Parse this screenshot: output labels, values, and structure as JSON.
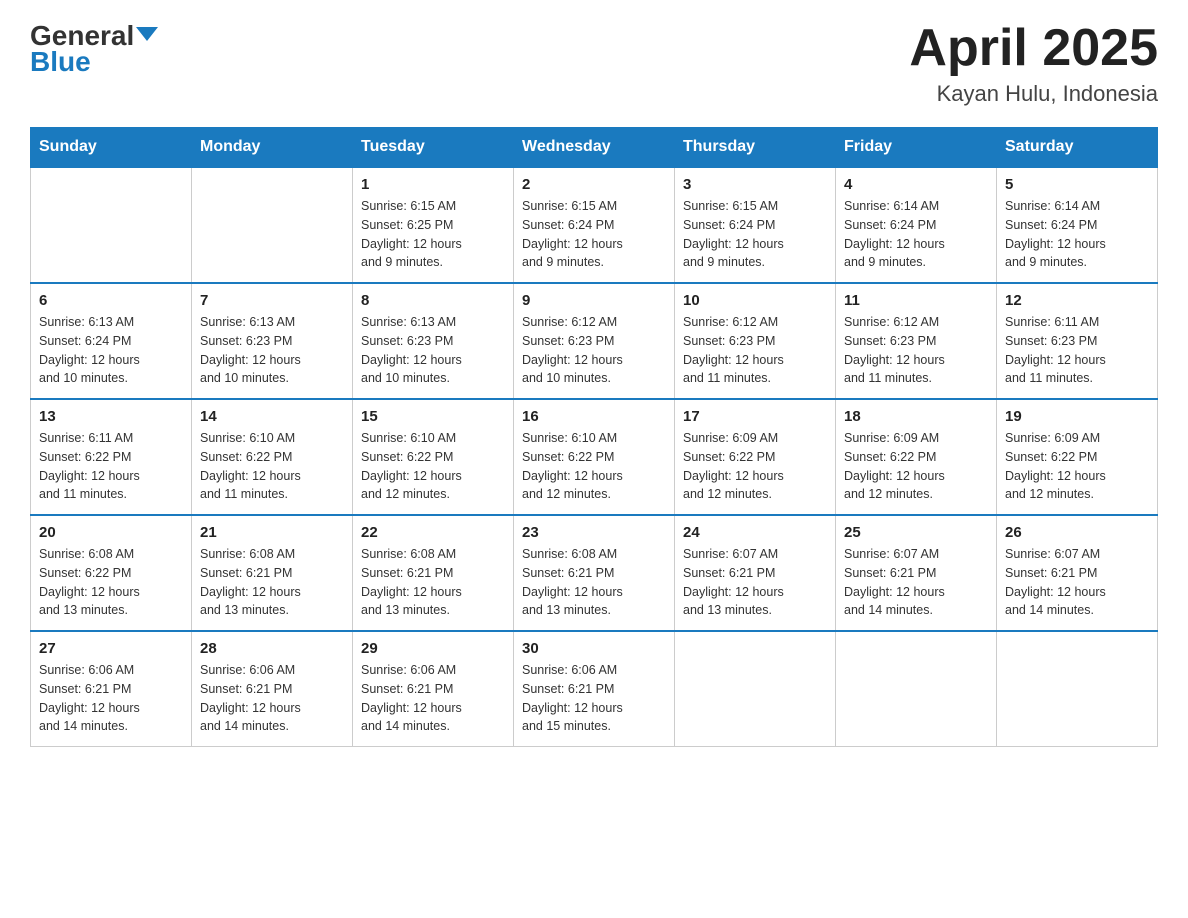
{
  "header": {
    "logo_general": "General",
    "logo_blue": "Blue",
    "title": "April 2025",
    "subtitle": "Kayan Hulu, Indonesia"
  },
  "days_of_week": [
    "Sunday",
    "Monday",
    "Tuesday",
    "Wednesday",
    "Thursday",
    "Friday",
    "Saturday"
  ],
  "weeks": [
    [
      {
        "day": "",
        "info": ""
      },
      {
        "day": "",
        "info": ""
      },
      {
        "day": "1",
        "info": "Sunrise: 6:15 AM\nSunset: 6:25 PM\nDaylight: 12 hours\nand 9 minutes."
      },
      {
        "day": "2",
        "info": "Sunrise: 6:15 AM\nSunset: 6:24 PM\nDaylight: 12 hours\nand 9 minutes."
      },
      {
        "day": "3",
        "info": "Sunrise: 6:15 AM\nSunset: 6:24 PM\nDaylight: 12 hours\nand 9 minutes."
      },
      {
        "day": "4",
        "info": "Sunrise: 6:14 AM\nSunset: 6:24 PM\nDaylight: 12 hours\nand 9 minutes."
      },
      {
        "day": "5",
        "info": "Sunrise: 6:14 AM\nSunset: 6:24 PM\nDaylight: 12 hours\nand 9 minutes."
      }
    ],
    [
      {
        "day": "6",
        "info": "Sunrise: 6:13 AM\nSunset: 6:24 PM\nDaylight: 12 hours\nand 10 minutes."
      },
      {
        "day": "7",
        "info": "Sunrise: 6:13 AM\nSunset: 6:23 PM\nDaylight: 12 hours\nand 10 minutes."
      },
      {
        "day": "8",
        "info": "Sunrise: 6:13 AM\nSunset: 6:23 PM\nDaylight: 12 hours\nand 10 minutes."
      },
      {
        "day": "9",
        "info": "Sunrise: 6:12 AM\nSunset: 6:23 PM\nDaylight: 12 hours\nand 10 minutes."
      },
      {
        "day": "10",
        "info": "Sunrise: 6:12 AM\nSunset: 6:23 PM\nDaylight: 12 hours\nand 11 minutes."
      },
      {
        "day": "11",
        "info": "Sunrise: 6:12 AM\nSunset: 6:23 PM\nDaylight: 12 hours\nand 11 minutes."
      },
      {
        "day": "12",
        "info": "Sunrise: 6:11 AM\nSunset: 6:23 PM\nDaylight: 12 hours\nand 11 minutes."
      }
    ],
    [
      {
        "day": "13",
        "info": "Sunrise: 6:11 AM\nSunset: 6:22 PM\nDaylight: 12 hours\nand 11 minutes."
      },
      {
        "day": "14",
        "info": "Sunrise: 6:10 AM\nSunset: 6:22 PM\nDaylight: 12 hours\nand 11 minutes."
      },
      {
        "day": "15",
        "info": "Sunrise: 6:10 AM\nSunset: 6:22 PM\nDaylight: 12 hours\nand 12 minutes."
      },
      {
        "day": "16",
        "info": "Sunrise: 6:10 AM\nSunset: 6:22 PM\nDaylight: 12 hours\nand 12 minutes."
      },
      {
        "day": "17",
        "info": "Sunrise: 6:09 AM\nSunset: 6:22 PM\nDaylight: 12 hours\nand 12 minutes."
      },
      {
        "day": "18",
        "info": "Sunrise: 6:09 AM\nSunset: 6:22 PM\nDaylight: 12 hours\nand 12 minutes."
      },
      {
        "day": "19",
        "info": "Sunrise: 6:09 AM\nSunset: 6:22 PM\nDaylight: 12 hours\nand 12 minutes."
      }
    ],
    [
      {
        "day": "20",
        "info": "Sunrise: 6:08 AM\nSunset: 6:22 PM\nDaylight: 12 hours\nand 13 minutes."
      },
      {
        "day": "21",
        "info": "Sunrise: 6:08 AM\nSunset: 6:21 PM\nDaylight: 12 hours\nand 13 minutes."
      },
      {
        "day": "22",
        "info": "Sunrise: 6:08 AM\nSunset: 6:21 PM\nDaylight: 12 hours\nand 13 minutes."
      },
      {
        "day": "23",
        "info": "Sunrise: 6:08 AM\nSunset: 6:21 PM\nDaylight: 12 hours\nand 13 minutes."
      },
      {
        "day": "24",
        "info": "Sunrise: 6:07 AM\nSunset: 6:21 PM\nDaylight: 12 hours\nand 13 minutes."
      },
      {
        "day": "25",
        "info": "Sunrise: 6:07 AM\nSunset: 6:21 PM\nDaylight: 12 hours\nand 14 minutes."
      },
      {
        "day": "26",
        "info": "Sunrise: 6:07 AM\nSunset: 6:21 PM\nDaylight: 12 hours\nand 14 minutes."
      }
    ],
    [
      {
        "day": "27",
        "info": "Sunrise: 6:06 AM\nSunset: 6:21 PM\nDaylight: 12 hours\nand 14 minutes."
      },
      {
        "day": "28",
        "info": "Sunrise: 6:06 AM\nSunset: 6:21 PM\nDaylight: 12 hours\nand 14 minutes."
      },
      {
        "day": "29",
        "info": "Sunrise: 6:06 AM\nSunset: 6:21 PM\nDaylight: 12 hours\nand 14 minutes."
      },
      {
        "day": "30",
        "info": "Sunrise: 6:06 AM\nSunset: 6:21 PM\nDaylight: 12 hours\nand 15 minutes."
      },
      {
        "day": "",
        "info": ""
      },
      {
        "day": "",
        "info": ""
      },
      {
        "day": "",
        "info": ""
      }
    ]
  ]
}
